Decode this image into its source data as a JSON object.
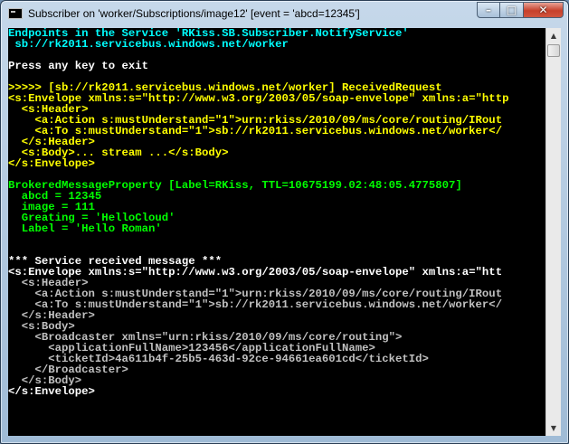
{
  "window": {
    "title": "Subscriber on 'worker/Subscriptions/image12' [event = 'abcd=12345']",
    "buttons": {
      "minimize": "–",
      "maximize": "□",
      "close": "✕"
    }
  },
  "scrollbar": {
    "up_arrow": "▲",
    "down_arrow": "▼"
  },
  "console": {
    "lines": [
      {
        "text": "Endpoints in the Service 'RKiss.SB.Subscriber.NotifyService'",
        "color": "cyan"
      },
      {
        "text": " sb://rk2011.servicebus.windows.net/worker",
        "color": "cyan"
      },
      {
        "text": "",
        "color": "white"
      },
      {
        "text": "Press any key to exit",
        "color": "white"
      },
      {
        "text": "",
        "color": "white"
      },
      {
        "text": ">>>>> [sb://rk2011.servicebus.windows.net/worker] ReceivedRequest",
        "color": "yellow"
      },
      {
        "text": "<s:Envelope xmlns:s=\"http://www.w3.org/2003/05/soap-envelope\" xmlns:a=\"http",
        "color": "yellow"
      },
      {
        "text": "  <s:Header>",
        "color": "yellow"
      },
      {
        "text": "    <a:Action s:mustUnderstand=\"1\">urn:rkiss/2010/09/ms/core/routing/IRout",
        "color": "yellow"
      },
      {
        "text": "    <a:To s:mustUnderstand=\"1\">sb://rk2011.servicebus.windows.net/worker</",
        "color": "yellow"
      },
      {
        "text": "  </s:Header>",
        "color": "yellow"
      },
      {
        "text": "  <s:Body>... stream ...</s:Body>",
        "color": "yellow"
      },
      {
        "text": "</s:Envelope>",
        "color": "yellow"
      },
      {
        "text": "",
        "color": "white"
      },
      {
        "text": "BrokeredMessageProperty [Label=RKiss, TTL=10675199.02:48:05.4775807]",
        "color": "green"
      },
      {
        "text": "  abcd = 12345",
        "color": "green"
      },
      {
        "text": "  image = 111",
        "color": "green"
      },
      {
        "text": "  Greating = 'HelloCloud'",
        "color": "green"
      },
      {
        "text": "  Label = 'Hello Roman'",
        "color": "green"
      },
      {
        "text": "",
        "color": "white"
      },
      {
        "text": "",
        "color": "white"
      },
      {
        "text": "*** Service received message ***",
        "color": "white"
      },
      {
        "text": "<s:Envelope xmlns:s=\"http://www.w3.org/2003/05/soap-envelope\" xmlns:a=\"htt",
        "color": "white"
      },
      {
        "text": "  <s:Header>",
        "color": "c0"
      },
      {
        "text": "    <a:Action s:mustUnderstand=\"1\">urn:rkiss/2010/09/ms/core/routing/IRout",
        "color": "c0"
      },
      {
        "text": "    <a:To s:mustUnderstand=\"1\">sb://rk2011.servicebus.windows.net/worker</",
        "color": "c0"
      },
      {
        "text": "  </s:Header>",
        "color": "c0"
      },
      {
        "text": "  <s:Body>",
        "color": "c0"
      },
      {
        "text": "    <Broadcaster xmlns=\"urn:rkiss/2010/09/ms/core/routing\">",
        "color": "c0"
      },
      {
        "text": "      <applicationFullName>123456</applicationFullName>",
        "color": "c0"
      },
      {
        "text": "      <ticketId>4a611b4f-25b5-463d-92ce-94661ea601cd</ticketId>",
        "color": "c0"
      },
      {
        "text": "    </Broadcaster>",
        "color": "c0"
      },
      {
        "text": "  </s:Body>",
        "color": "c0"
      },
      {
        "text": "</s:Envelope>",
        "color": "white"
      }
    ]
  }
}
